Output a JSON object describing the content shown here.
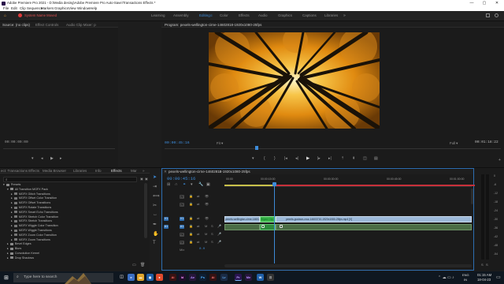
{
  "window": {
    "title": "Adobe Premiere Pro 2021 - D:\\Media desing\\Adobe Premiere Pro Auto-Save\\Transactions Effects *",
    "controls": [
      "—",
      "▢",
      "✕"
    ]
  },
  "menu": [
    "File",
    "Edit",
    "Clip",
    "Sequence",
    "Markers",
    "Graphics",
    "View",
    "Window",
    "Help"
  ],
  "notice": "System Name Moved",
  "workspaces": {
    "items": [
      "Learning",
      "Assembly",
      "Editing",
      "Color",
      "Effects",
      "Audio",
      "Graphics",
      "Captions",
      "Libraries"
    ],
    "active": "Editing"
  },
  "source_panel": {
    "tabs": [
      "Source: (no clips)",
      "Effect Controls",
      "Audio Clip Mixer: p"
    ],
    "timecode": "00:00:00:00"
  },
  "program_panel": {
    "tab": "Program: pexels-wellington-cirne-14602818-1920x1080-25fps",
    "timecode": "00:00:45:16",
    "fit": "Fit",
    "quality": "Full",
    "duration": "00:01:18:22"
  },
  "effects_panel": {
    "tabs": [
      "ect: Transactions Effects",
      "Media Browser",
      "Libraries",
      "Info",
      "Effects",
      "Mar"
    ],
    "search_placeholder": "",
    "tree": [
      {
        "label": "Presets",
        "level": 0,
        "type": "folder"
      },
      {
        "label": "All Transition MGFX Pack",
        "level": 1,
        "type": "folder"
      },
      {
        "label": "MGFX Glitch Transitions",
        "level": 2,
        "type": "preset"
      },
      {
        "label": "MGFX Offset Color Transition",
        "level": 2,
        "type": "preset"
      },
      {
        "label": "MGFX Offset Transitions",
        "level": 2,
        "type": "preset"
      },
      {
        "label": "MGFX Rotate Transitions",
        "level": 2,
        "type": "preset"
      },
      {
        "label": "MGFX Smart Echo Transitions",
        "level": 2,
        "type": "preset"
      },
      {
        "label": "MGFX Stretch Color Transition",
        "level": 2,
        "type": "preset"
      },
      {
        "label": "MGFX Stretch Transitions",
        "level": 2,
        "type": "preset"
      },
      {
        "label": "MGFX Wiggle Color Transition",
        "level": 2,
        "type": "preset"
      },
      {
        "label": "MGFX Wiggle Transitions",
        "level": 2,
        "type": "preset"
      },
      {
        "label": "MGFX Zoom Color Transition",
        "level": 2,
        "type": "preset"
      },
      {
        "label": "MGFX Zoom Transitions",
        "level": 2,
        "type": "preset"
      },
      {
        "label": "Bevel Edges",
        "level": 1,
        "type": "folder"
      },
      {
        "label": "Blurs",
        "level": 1,
        "type": "folder"
      },
      {
        "label": "Convolution Kernel",
        "level": 1,
        "type": "folder"
      },
      {
        "label": "Drop Shadows",
        "level": 1,
        "type": "folder"
      }
    ]
  },
  "timeline": {
    "tab": "pexels-wellington-cirne-14602818-1920x1080-25fps",
    "timecode": "00:00:45:16",
    "ruler": [
      "00:00",
      "00:00:15:00",
      "00:00:30:00",
      "00:00:45:00",
      "00:01:00:00"
    ],
    "video_tracks": [
      "V3",
      "V2",
      "V1"
    ],
    "audio_tracks": [
      "A1",
      "A2",
      "A3"
    ],
    "mix_label": "Mix",
    "mix_value": "0.0",
    "clips": {
      "clip1": "pexels-wellington-cirne-14602818-1920x1080-25fps.mp4 [V]",
      "clip2": "Wiped Clip",
      "clip3": "pexels-gustavo-cruz-14603710-1920x1080-25fps.mp4 [V]"
    }
  },
  "meter_scale": [
    "0",
    "-6",
    "-12",
    "-18",
    "-24",
    "-30",
    "-36",
    "-42",
    "-48",
    "-54"
  ],
  "taskbar": {
    "search_placeholder": "Type here to search",
    "lang": "ENG",
    "region": "IN",
    "time": "01:15 AM",
    "date": "18-04-23"
  },
  "colors": {
    "accent_blue": "#2d8ceb",
    "video_clip": "#9bb8d8",
    "audio_clip": "#4a6c45",
    "selected_clip": "#3cb44b",
    "playhead": "#3d8bd8"
  }
}
